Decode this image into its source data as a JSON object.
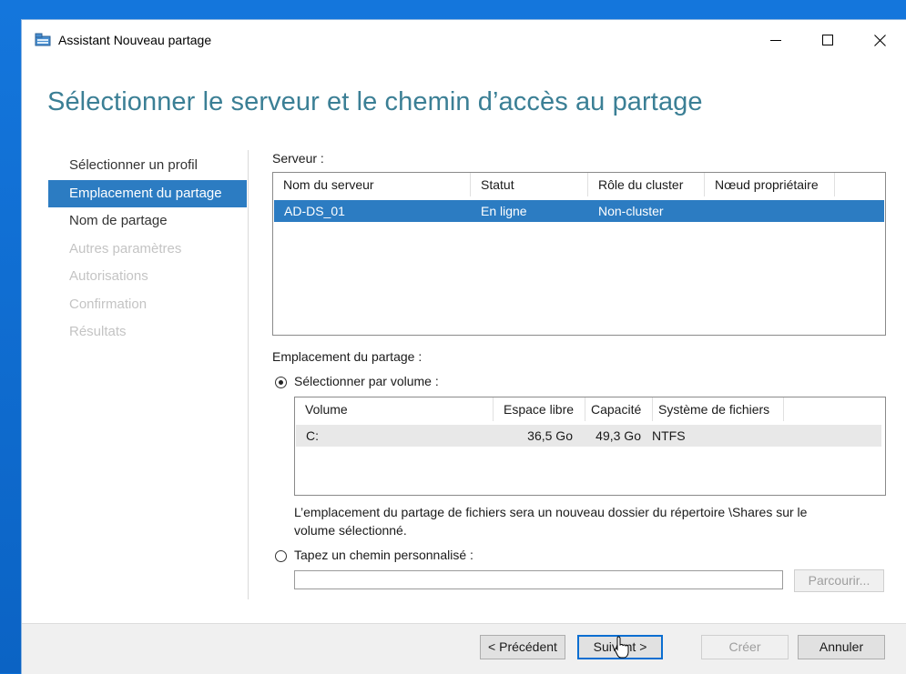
{
  "window": {
    "title": "Assistant Nouveau partage",
    "heading": "Sélectionner le serveur et le chemin d’accès au partage"
  },
  "nav": {
    "items": [
      {
        "label": "Sélectionner un profil",
        "state": "normal"
      },
      {
        "label": "Emplacement du partage",
        "state": "active"
      },
      {
        "label": "Nom de partage",
        "state": "normal"
      },
      {
        "label": "Autres paramètres",
        "state": "disabled"
      },
      {
        "label": "Autorisations",
        "state": "disabled"
      },
      {
        "label": "Confirmation",
        "state": "disabled"
      },
      {
        "label": "Résultats",
        "state": "disabled"
      }
    ]
  },
  "server": {
    "label": "Serveur :",
    "columns": [
      "Nom du serveur",
      "Statut",
      "Rôle du cluster",
      "Nœud propriétaire"
    ],
    "rows": [
      [
        "AD-DS_01",
        "En ligne",
        "Non-cluster",
        ""
      ]
    ]
  },
  "location": {
    "label": "Emplacement du partage :",
    "by_volume_label": "Sélectionner par volume :",
    "volume_columns": [
      "Volume",
      "Espace libre",
      "Capacité",
      "Système de fichiers"
    ],
    "volume_rows": [
      [
        "C:",
        "36,5 Go",
        "49,3 Go",
        "NTFS"
      ]
    ],
    "info_line1": "L’emplacement du partage de fichiers sera un nouveau dossier du répertoire \\Shares sur le",
    "info_line2": "volume sélectionné.",
    "custom_path_label": "Tapez un chemin personnalisé :",
    "custom_path_value": "",
    "browse_label": "Parcourir..."
  },
  "buttons": {
    "previous": "< Précédent",
    "next": "Suivant >",
    "create": "Créer",
    "cancel": "Annuler"
  },
  "colors": {
    "accent": "#2c7cc2",
    "heading": "#3b7f95",
    "desktop": "#0a6fd6"
  }
}
